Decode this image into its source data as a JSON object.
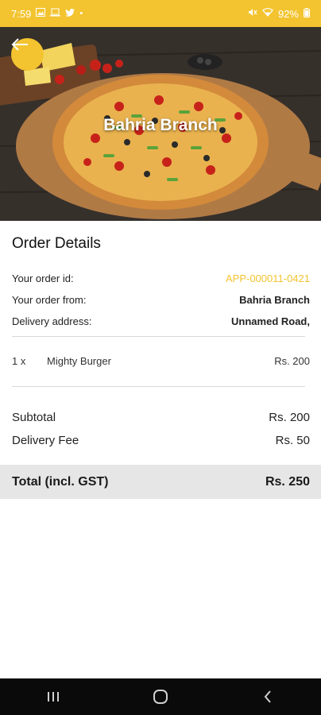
{
  "status_bar": {
    "time": "7:59",
    "battery": "92%",
    "left_icons": [
      "gallery-icon",
      "laptop-icon",
      "twitter-icon",
      "dot-icon"
    ],
    "right_icons": [
      "mute-icon",
      "wifi-icon",
      "battery-icon"
    ]
  },
  "hero": {
    "title": "Bahria Branch",
    "back_icon": "arrow-left-icon",
    "accent": "#f3c430"
  },
  "order_details": {
    "heading": "Order Details",
    "rows": [
      {
        "label": "Your order id:",
        "value": "APP-000011-0421"
      },
      {
        "label": "Your order from:",
        "value": "Bahria Branch"
      },
      {
        "label": "Delivery address:",
        "value": "Unnamed Road,"
      }
    ]
  },
  "items": [
    {
      "qty": "1 x",
      "name": "Mighty Burger",
      "price": "Rs. 200"
    }
  ],
  "summary": {
    "subtotal_label": "Subtotal",
    "subtotal_value": "Rs. 200",
    "delivery_label": "Delivery Fee",
    "delivery_value": "Rs. 50",
    "total_label": "Total (incl. GST)",
    "total_value": "Rs. 250"
  },
  "nav_bar": {
    "buttons": [
      "recents-icon",
      "home-icon",
      "back-icon"
    ]
  }
}
